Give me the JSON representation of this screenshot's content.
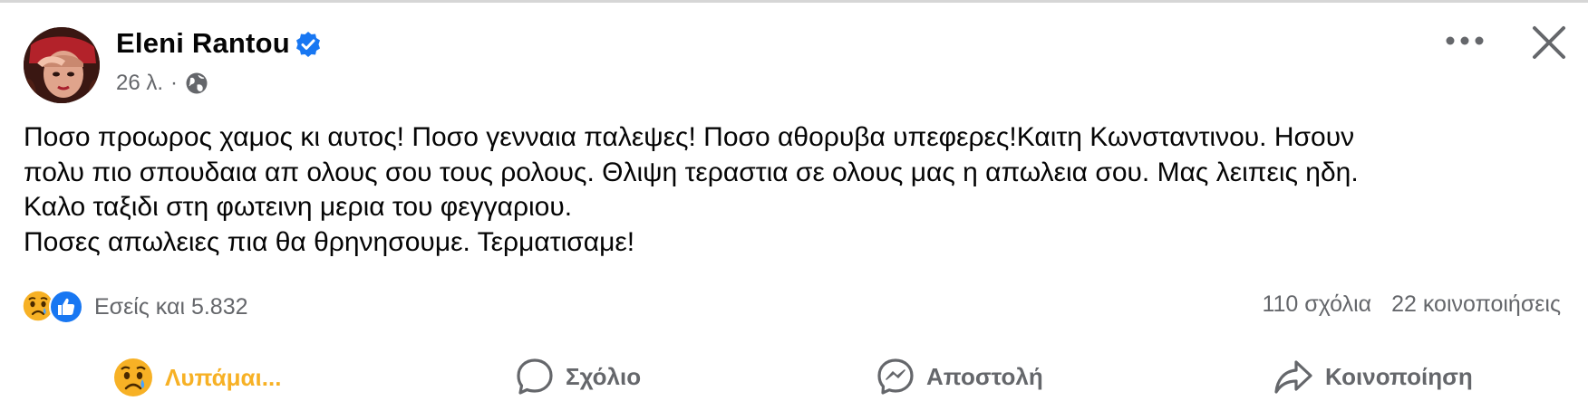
{
  "post": {
    "author": "Eleni Rantou",
    "verified": true,
    "time": "26 λ.",
    "separator": "·",
    "audience_icon": "globe-icon",
    "text_lines": [
      "Ποσο πρoωρος χαμος κι αυτος! Ποσο γενναια παλεψες! Ποσο αθορυβα υπεφερες!Καιτη Κωνσταντινου. Ησουν",
      "πολυ πιο σπουδαια απ ολους σου τους ρολους. Θλιψη τεραστια σε ολους μας η απωλεια σου. Μας λειπεις ηδη.",
      "Καλο ταξιδι στη φωτεινη μερια του φεγγαριου.",
      "Ποσες απωλειες πια θα θρηνησουμε. Τερματισαμε!"
    ]
  },
  "reactions": {
    "icons": [
      "sad-emoji-icon",
      "like-icon"
    ],
    "summary": "Εσείς και 5.832",
    "comments": "110 σχόλια",
    "shares": "22 κοινοποιήσεις"
  },
  "actions": {
    "react": "Λυπάμαι...",
    "comment": "Σχόλιο",
    "send": "Αποστολή",
    "share": "Κοινοποίηση"
  },
  "colors": {
    "verified": "#1877f2",
    "like": "#1877f2",
    "sad_reaction": "#f7b125",
    "secondary_text": "#65676b"
  }
}
